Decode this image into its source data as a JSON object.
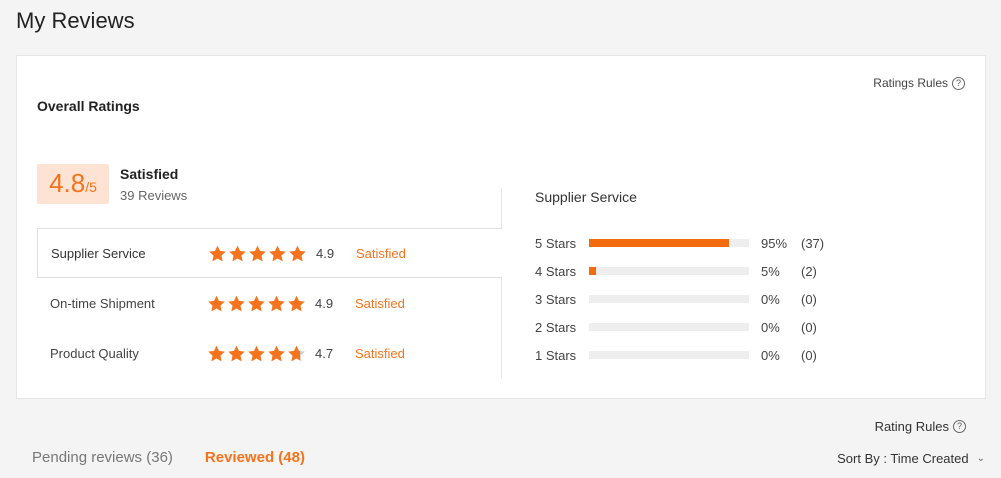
{
  "page": {
    "title": "My Reviews"
  },
  "overall": {
    "section_title": "Overall Ratings",
    "rules_label": "Ratings Rules",
    "score": "4.8",
    "score_max": "/5",
    "score_value": 4.8,
    "summary_label": "Satisfied",
    "reviews_count": "39 Reviews"
  },
  "categories": [
    {
      "name": "Supplier Service",
      "value": "4.9",
      "rating": 4.9,
      "status": "Satisfied"
    },
    {
      "name": "On-time Shipment",
      "value": "4.9",
      "rating": 4.9,
      "status": "Satisfied"
    },
    {
      "name": "Product Quality",
      "value": "4.7",
      "rating": 4.7,
      "status": "Satisfied"
    }
  ],
  "distribution": {
    "title": "Supplier Service",
    "rows": [
      {
        "label": "5  Stars",
        "percent": "95%",
        "count": "(37)",
        "fraction": 0.95
      },
      {
        "label": "4  Stars",
        "percent": "5%",
        "count": "(2)",
        "fraction": 0.05
      },
      {
        "label": "3  Stars",
        "percent": "0%",
        "count": "(0)",
        "fraction": 0
      },
      {
        "label": "2  Stars",
        "percent": "0%",
        "count": "(0)",
        "fraction": 0
      },
      {
        "label": "1  Stars",
        "percent": "0%",
        "count": "(0)",
        "fraction": 0
      }
    ]
  },
  "footer": {
    "rating_rules_label": "Rating Rules",
    "tabs": [
      {
        "label": "Pending reviews (36)",
        "active": false
      },
      {
        "label": "Reviewed (48)",
        "active": true
      }
    ],
    "sort_label": "Sort By : Time Created"
  },
  "colors": {
    "accent": "#f5731c",
    "bar": "#f26b0f",
    "score_bg": "#fde3d3"
  }
}
